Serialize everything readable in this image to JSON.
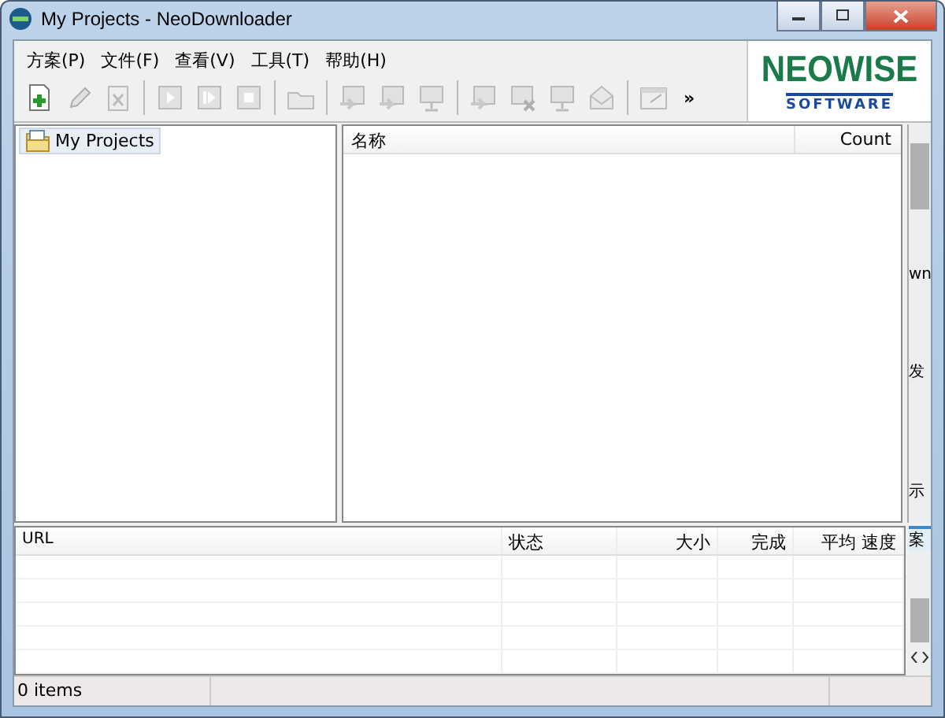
{
  "window": {
    "title": "My Projects - NeoDownloader"
  },
  "menu": [
    {
      "label": "方案(P)"
    },
    {
      "label": "文件(F)"
    },
    {
      "label": "查看(V)"
    },
    {
      "label": "工具(T)"
    },
    {
      "label": "帮助(H)"
    }
  ],
  "toolbar": [
    {
      "kind": "new",
      "disabled": false
    },
    {
      "kind": "edit",
      "disabled": true
    },
    {
      "kind": "delete",
      "disabled": true
    },
    {
      "kind": "separator"
    },
    {
      "kind": "play",
      "disabled": true
    },
    {
      "kind": "step",
      "disabled": true
    },
    {
      "kind": "stop",
      "disabled": true
    },
    {
      "kind": "separator"
    },
    {
      "kind": "folder",
      "disabled": true
    },
    {
      "kind": "separator"
    },
    {
      "kind": "image",
      "disabled": true
    },
    {
      "kind": "image",
      "disabled": true
    },
    {
      "kind": "screen",
      "disabled": true
    },
    {
      "kind": "separator"
    },
    {
      "kind": "image",
      "disabled": true
    },
    {
      "kind": "image-x",
      "disabled": true
    },
    {
      "kind": "screen",
      "disabled": true
    },
    {
      "kind": "mail",
      "disabled": true
    },
    {
      "kind": "separator"
    },
    {
      "kind": "window",
      "disabled": true
    }
  ],
  "toolbar_more": "»",
  "logo": {
    "name": "NEOWISE",
    "subtitle": "SOFTWARE"
  },
  "tree": {
    "items": [
      {
        "label": "My Projects",
        "selected": true
      }
    ]
  },
  "projects_table": {
    "columns": [
      "名称",
      "Count"
    ]
  },
  "side_strip": [
    "wn",
    "发",
    "示",
    "案"
  ],
  "downloads_table": {
    "columns": [
      "URL",
      "状态",
      "大小",
      "完成",
      "平均 速度"
    ]
  },
  "status_bar": {
    "text": "0 items"
  }
}
